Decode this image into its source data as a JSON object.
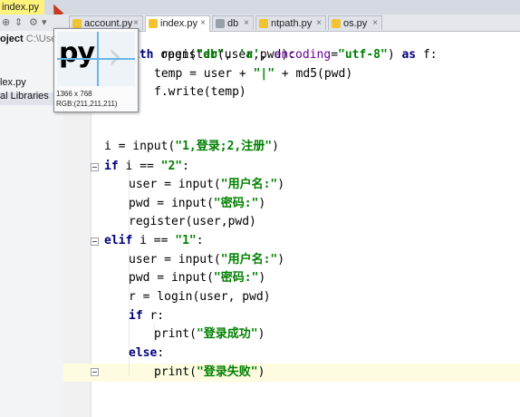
{
  "window": {
    "title": "index.py"
  },
  "project": {
    "label": "oject",
    "path": "C:\\User",
    "items": [
      "lex.py",
      "al Libraries"
    ]
  },
  "tabs": [
    {
      "label": "account.py",
      "close": "×",
      "color": "#f1c232",
      "active": false
    },
    {
      "label": "index.py",
      "close": "×",
      "color": "#f1c232",
      "active": true
    },
    {
      "label": "db",
      "close": "×",
      "color": "#9aa0aa",
      "active": false
    },
    {
      "label": "ntpath.py",
      "close": "×",
      "color": "#f1c232",
      "active": false
    },
    {
      "label": "os.py",
      "close": "×",
      "color": "#f1c232",
      "active": false
    }
  ],
  "magnifier": {
    "preview": "py",
    "resolution": "1366 x 768",
    "rgb": "RGB:(211,211,211)"
  },
  "code": {
    "l1": {
      "text": "register(user,pwd):"
    },
    "l2": {
      "kw1": "ith",
      "a": " open(",
      "s1": "\"db\"",
      "b": ", ",
      "s2": "'a'",
      "c": ", ",
      "named": "encoding",
      "d": "=",
      "s3": "\"utf-8\"",
      "e": ") ",
      "kw2": "as",
      "f": " f:"
    },
    "l3": {
      "a": "temp = user + ",
      "s1": "\"|\"",
      "b": " + md5(pwd)"
    },
    "l4": {
      "a": "f.write(temp)"
    },
    "l5": {
      "a": "i = input(",
      "s1": "\"1,登录;2,注册\"",
      "b": ")"
    },
    "l6": {
      "kw": "if",
      "a": " i == ",
      "s1": "\"2\"",
      "b": ":"
    },
    "l7": {
      "a": "user = input(",
      "s1": "\"用户名:\"",
      "b": ")"
    },
    "l8": {
      "a": "pwd = input(",
      "s1": "\"密码:\"",
      "b": ")"
    },
    "l9": {
      "a": "register(user,pwd)"
    },
    "l10": {
      "kw": "elif",
      "a": " i == ",
      "s1": "\"1\"",
      "b": ":"
    },
    "l11": {
      "a": "user = input(",
      "s1": "\"用户名:\"",
      "b": ")"
    },
    "l12": {
      "a": "pwd = input(",
      "s1": "\"密码:\"",
      "b": ")"
    },
    "l13": {
      "a": "r = login(user, pwd)"
    },
    "l14": {
      "kw": "if",
      "a": " r:"
    },
    "l15": {
      "a": "print(",
      "s1": "\"登录成功\"",
      "b": ")"
    },
    "l16": {
      "kw": "else",
      "a": ":"
    },
    "l17": {
      "a": "print(",
      "s1": "\"登录失败\"",
      "b": ")"
    }
  }
}
